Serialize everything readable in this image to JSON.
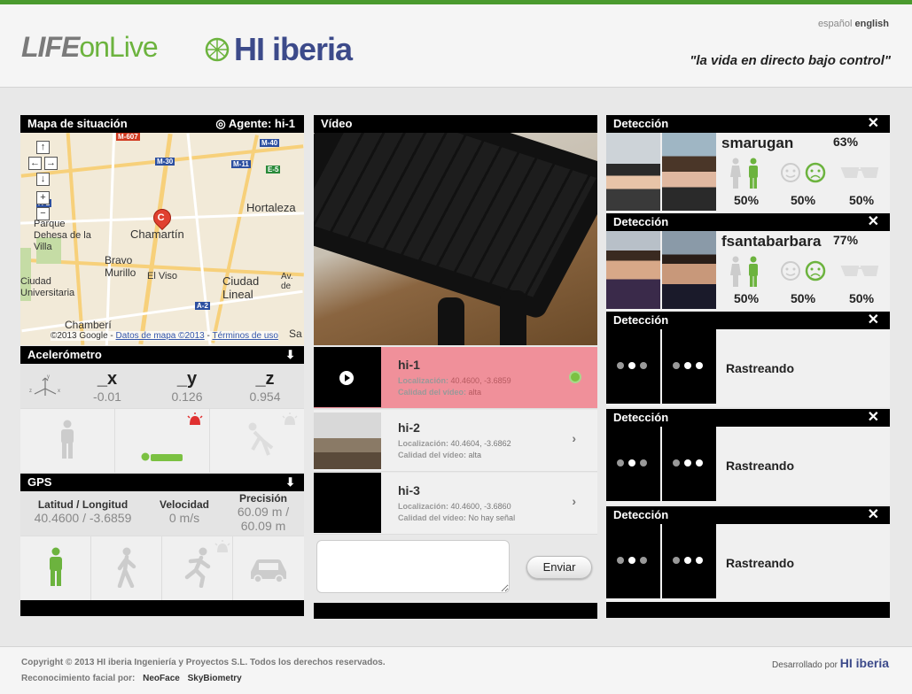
{
  "header": {
    "logo_life": "LIFE",
    "logo_on": "on",
    "logo_live": "Live",
    "logo_hi": "HI iberia",
    "lang_es": "español",
    "lang_en": "english",
    "slogan": "\"la vida en directo bajo control\""
  },
  "map_panel": {
    "title": "Mapa de situación",
    "agent_label": "◎ Agente: hi-1",
    "pin_letter": "C",
    "labels": {
      "hortaleza": "Hortaleza",
      "parque": "Parque Dehesa de la Villa",
      "chamartin": "Chamartín",
      "bravo": "Bravo Murillo",
      "elviso": "El Viso",
      "ciudad": "Ciudad Lineal",
      "ciudad_u": "Ciudad Universitaria",
      "chamberi": "Chamberí",
      "av_de": "Av. de",
      "sa": "Sa"
    },
    "shields": {
      "m607": "M-607",
      "m40": "M-40",
      "m30": "M-30",
      "m11": "M-11",
      "e5": "E-5",
      "a1": "A-1",
      "a2": "A-2"
    },
    "copyright": "©2013 Google -",
    "link_data": "Datos de mapa ©2013",
    "link_terms": "Términos de uso"
  },
  "accel": {
    "title": "Acelerómetro",
    "x_label": "_x",
    "x_value": "-0.01",
    "y_label": "_y",
    "y_value": "0.126",
    "z_label": "_z",
    "z_value": "0.954"
  },
  "gps": {
    "title": "GPS",
    "latlon_label": "Latitud / Longitud",
    "latlon_value": "40.4600 / -3.6859",
    "speed_label": "Velocidad",
    "speed_value": "0 m/s",
    "precision_label": "Precisión",
    "precision_value1": "60.09 m /",
    "precision_value2": "60.09 m"
  },
  "video": {
    "title": "Vídeo",
    "agents": [
      {
        "name": "hi-1",
        "loc_label": "Localización:",
        "loc": "40.4600, -3.6859",
        "q_label": "Calidad del vídeo:",
        "q": "alta"
      },
      {
        "name": "hi-2",
        "loc_label": "Localización:",
        "loc": "40.4604, -3.6862",
        "q_label": "Calidad del vídeo:",
        "q": "alta"
      },
      {
        "name": "hi-3",
        "loc_label": "Localización:",
        "loc": "40.4600, -3.6860",
        "q_label": "Calidad del vídeo:",
        "q": "No hay señal"
      }
    ],
    "send_label": "Enviar"
  },
  "detection": {
    "title": "Detección",
    "items": [
      {
        "user": "smarugan",
        "score": "63%",
        "gender": "50%",
        "emotion": "50%",
        "glasses": "50%"
      },
      {
        "user": "fsantabarbara",
        "score": "77%",
        "gender": "50%",
        "emotion": "50%",
        "glasses": "50%"
      }
    ],
    "tracking": "Rastreando"
  },
  "footer": {
    "copyright": "Copyright © 2013 HI iberia Ingeniería y Proyectos S.L. Todos los derechos reservados.",
    "face_label": "Reconocimiento facial por:",
    "face_1": "NeoFace",
    "face_2": "SkyBiometry",
    "dev_label": "Desarrollado por",
    "dev_name": "HI iberia"
  },
  "colors": {
    "accent_green": "#6cb33e",
    "brand_blue": "#3c4a8a",
    "alert_red": "#e03030",
    "active_row": "#f0909a"
  }
}
